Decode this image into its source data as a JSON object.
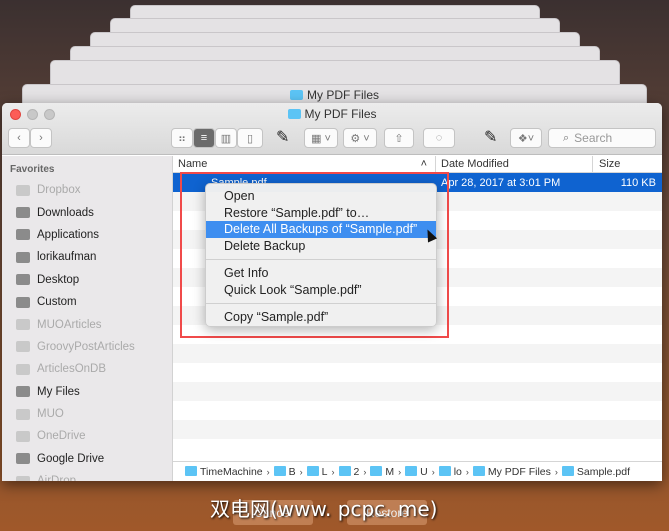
{
  "window": {
    "title": "My PDF Files",
    "back_title": "My PDF Files"
  },
  "toolbar": {
    "search_placeholder": "Search"
  },
  "sidebar": {
    "header": "Favorites",
    "items": [
      {
        "label": "Dropbox",
        "dim": true
      },
      {
        "label": "Downloads",
        "dim": false
      },
      {
        "label": "Applications",
        "dim": false
      },
      {
        "label": "lorikaufman",
        "dim": false
      },
      {
        "label": "Desktop",
        "dim": false
      },
      {
        "label": "Custom",
        "dim": false
      },
      {
        "label": "MUOArticles",
        "dim": true
      },
      {
        "label": "GroovyPostArticles",
        "dim": true
      },
      {
        "label": "ArticlesOnDB",
        "dim": true
      },
      {
        "label": "My Files",
        "dim": false
      },
      {
        "label": "MUO",
        "dim": true
      },
      {
        "label": "OneDrive",
        "dim": true
      },
      {
        "label": "Google Drive",
        "dim": false
      },
      {
        "label": "AirDrop",
        "dim": true
      }
    ]
  },
  "columns": {
    "name": "Name",
    "date": "Date Modified",
    "size": "Size"
  },
  "file": {
    "name": "Sample.pdf",
    "date": "Apr 28, 2017 at 3:01 PM",
    "size": "110 KB"
  },
  "menu": {
    "open": "Open",
    "restore": "Restore “Sample.pdf” to…",
    "delete_all": "Delete All Backups of “Sample.pdf”",
    "delete_backup": "Delete Backup",
    "get_info": "Get Info",
    "quick_look": "Quick Look “Sample.pdf”",
    "copy": "Copy “Sample.pdf”"
  },
  "pathbar": [
    "TimeMachine",
    "B",
    "L",
    "2",
    "M",
    "U",
    "lo",
    "My PDF Files",
    "Sample.pdf"
  ],
  "bottom": {
    "cancel": "Cancel",
    "restore": "Restore"
  },
  "watermark": "双电网(www. pcpc. me)"
}
